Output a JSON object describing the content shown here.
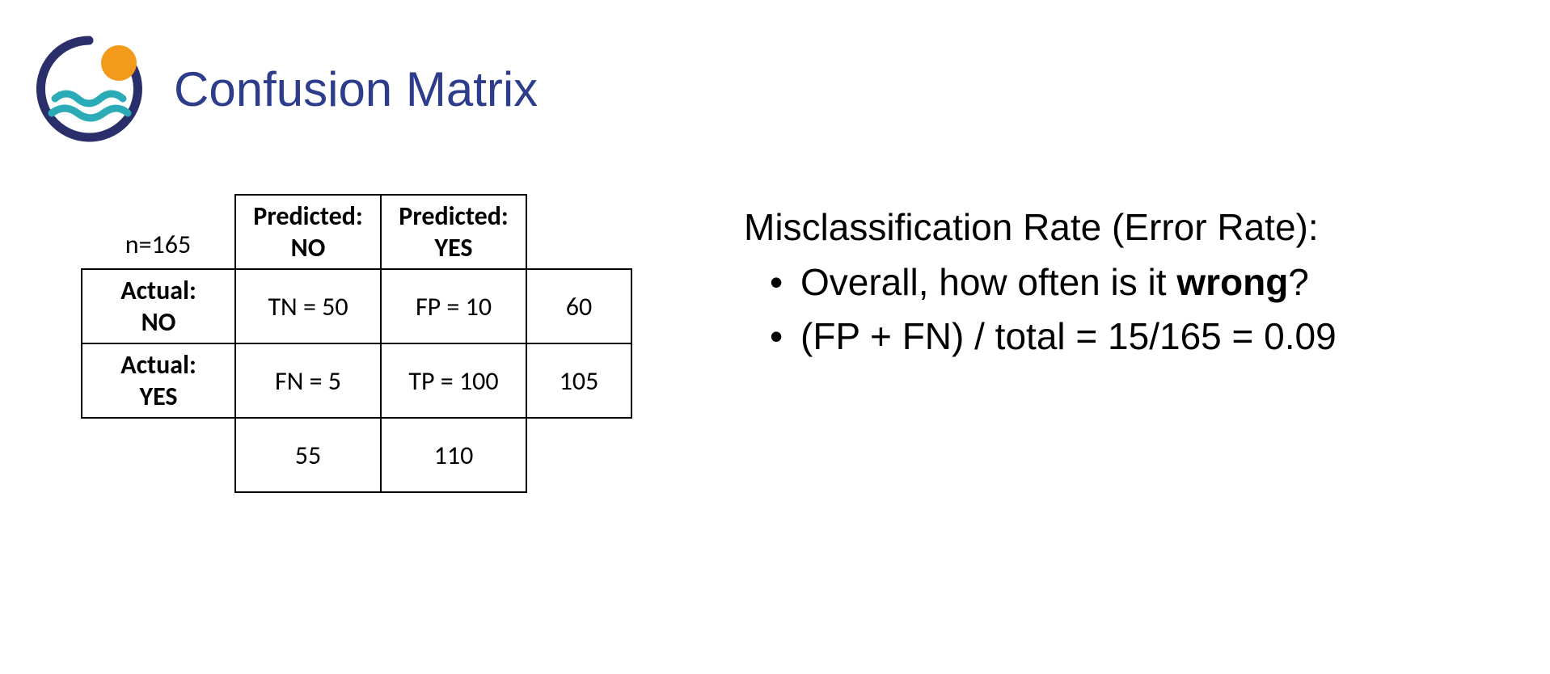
{
  "title": "Confusion Matrix",
  "confusion_matrix": {
    "n_label": "n=165",
    "col_headers": [
      "Predicted: NO",
      "Predicted: YES"
    ],
    "row_headers": [
      "Actual: NO",
      "Actual: YES"
    ],
    "cells": {
      "tn": "TN = 50",
      "fp": "FP = 10",
      "fn": "FN = 5",
      "tp": "TP = 100"
    },
    "row_totals": [
      "60",
      "105"
    ],
    "col_totals": [
      "55",
      "110"
    ]
  },
  "right_panel": {
    "heading": "Misclassification Rate (Error Rate):",
    "bullet1_pre": "Overall, how often is it ",
    "bullet1_bold": "wrong",
    "bullet1_post": "?",
    "bullet2": "(FP + FN) / total = 15/165 = 0.09"
  },
  "chart_data": {
    "type": "table",
    "n": 165,
    "rows": [
      "Actual: NO",
      "Actual: YES"
    ],
    "columns": [
      "Predicted: NO",
      "Predicted: YES"
    ],
    "values": [
      [
        50,
        10
      ],
      [
        5,
        100
      ]
    ],
    "row_totals": [
      60,
      105
    ],
    "col_totals": [
      55,
      110
    ],
    "metric": {
      "name": "Misclassification Rate",
      "formula": "(FP + FN) / total",
      "value": 0.09
    }
  }
}
